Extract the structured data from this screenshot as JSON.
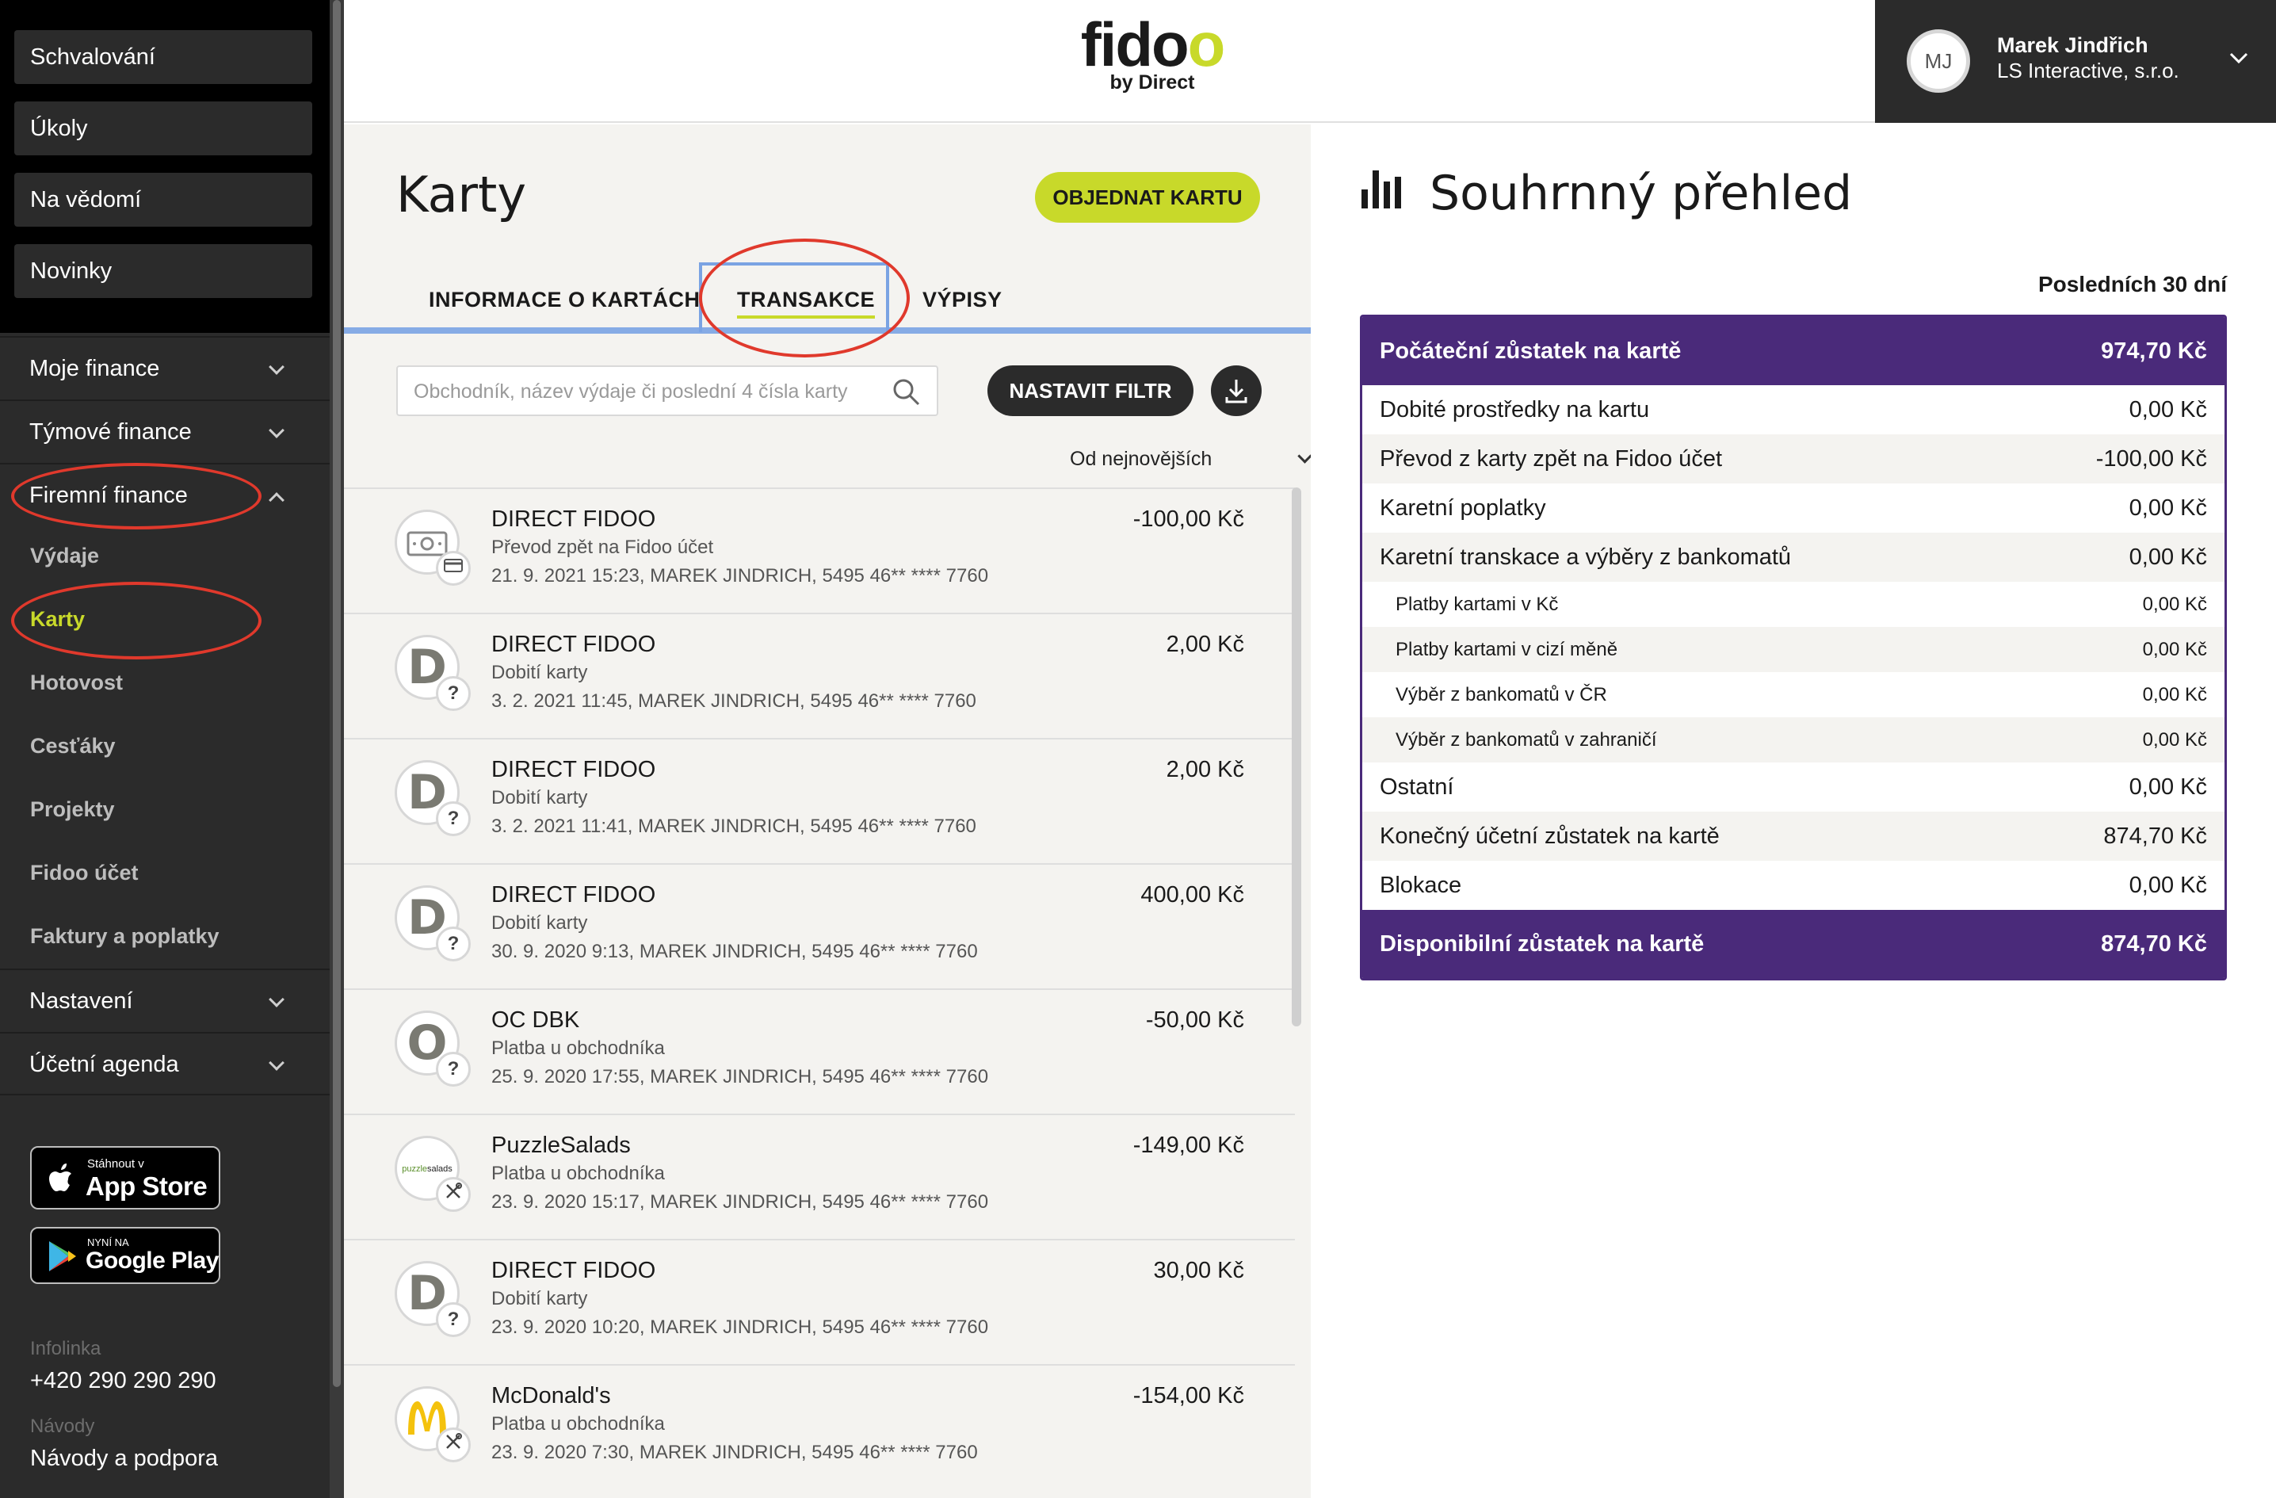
{
  "sidebar": {
    "top_buttons": [
      "Schvalování",
      "Úkoly",
      "Na vědomí",
      "Novinky"
    ],
    "sections": {
      "moje_finance": "Moje finance",
      "tymove_finance": "Týmové finance",
      "firemni_finance": "Firemní finance",
      "nastaveni": "Nastavení",
      "ucetni_agenda": "Účetní agenda"
    },
    "sub_items": [
      "Výdaje",
      "Karty",
      "Hotovost",
      "Cesťáky",
      "Projekty",
      "Fidoo účet",
      "Faktury a poplatky"
    ],
    "active_sub_item": "Karty",
    "app_store": {
      "small": "Stáhnout v",
      "big": "App Store"
    },
    "google_play": {
      "small": "NYNÍ NA",
      "big": "Google Play"
    },
    "hotline_label": "Infolinka",
    "hotline_value": "+420 290 290 290",
    "guides_label": "Návody",
    "guides_value": "Návody a podpora"
  },
  "header": {
    "logo_word": "fidoo",
    "logo_sub": "by Direct",
    "user": {
      "initials": "MJ",
      "name": "Marek Jindřich",
      "company": "LS Interactive, s.r.o."
    }
  },
  "cards_page": {
    "title": "Karty",
    "order_button": "OBJEDNAT KARTU",
    "tabs": {
      "info": "INFORMACE O KARTÁCH",
      "transactions": "TRANSAKCE",
      "statements": "VÝPISY"
    },
    "active_tab": "TRANSAKCE",
    "search_placeholder": "Obchodník, název výdaje či poslední 4 čísla karty",
    "filter_button": "NASTAVIT FILTR",
    "sort_label": "Od nejnovějších",
    "transactions": [
      {
        "merchant": "DIRECT FIDOO",
        "category": "Převod zpět na Fidoo účet",
        "meta": "21. 9. 2021 15:23, MAREK JINDRICH, 5495 46** **** 7760",
        "amount": "-100,00 Kč",
        "avatar": "money-icon",
        "badge": "card-icon"
      },
      {
        "merchant": "DIRECT FIDOO",
        "category": "Dobití karty",
        "meta": "3. 2. 2021 11:45, MAREK JINDRICH, 5495 46** **** 7760",
        "amount": "2,00 Kč",
        "avatar": "D",
        "badge": "?"
      },
      {
        "merchant": "DIRECT FIDOO",
        "category": "Dobití karty",
        "meta": "3. 2. 2021 11:41, MAREK JINDRICH, 5495 46** **** 7760",
        "amount": "2,00 Kč",
        "avatar": "D",
        "badge": "?"
      },
      {
        "merchant": "DIRECT FIDOO",
        "category": "Dobití karty",
        "meta": "30. 9. 2020 9:13, MAREK JINDRICH, 5495 46** **** 7760",
        "amount": "400,00 Kč",
        "avatar": "D",
        "badge": "?"
      },
      {
        "merchant": "OC DBK",
        "category": "Platba u obchodníka",
        "meta": "25. 9. 2020 17:55, MAREK JINDRICH, 5495 46** **** 7760",
        "amount": "-50,00 Kč",
        "avatar": "O",
        "badge": "?"
      },
      {
        "merchant": "PuzzleSalads",
        "category": "Platba u obchodníka",
        "meta": "23. 9. 2020 15:17, MAREK JINDRICH, 5495 46** **** 7760",
        "amount": "-149,00 Kč",
        "avatar": "puzzle-salads-logo",
        "badge": "cutlery-icon"
      },
      {
        "merchant": "DIRECT FIDOO",
        "category": "Dobití karty",
        "meta": "23. 9. 2020 10:20, MAREK JINDRICH, 5495 46** **** 7760",
        "amount": "30,00 Kč",
        "avatar": "D",
        "badge": "?"
      },
      {
        "merchant": "McDonald's",
        "category": "Platba u obchodníka",
        "meta": "23. 9. 2020 7:30, MAREK JINDRICH, 5495 46** **** 7760",
        "amount": "-154,00 Kč",
        "avatar": "mcdonalds-logo",
        "badge": "cutlery-icon"
      }
    ]
  },
  "summary": {
    "title": "Souhrnný přehled",
    "period": "Posledních 30 dní",
    "head": {
      "label": "Počáteční zůstatek na kartě",
      "value": "974,70 Kč"
    },
    "rows": [
      {
        "label": "Dobité prostředky na kartu",
        "value": "0,00 Kč",
        "sub": false
      },
      {
        "label": "Převod z karty zpět na Fidoo účet",
        "value": "-100,00 Kč",
        "sub": false
      },
      {
        "label": "Karetní poplatky",
        "value": "0,00 Kč",
        "sub": false
      },
      {
        "label": "Karetní transkace a výběry z bankomatů",
        "value": "0,00 Kč",
        "sub": false
      },
      {
        "label": "Platby kartami v Kč",
        "value": "0,00 Kč",
        "sub": true
      },
      {
        "label": "Platby kartami v cizí měně",
        "value": "0,00 Kč",
        "sub": true
      },
      {
        "label": "Výběr z bankomatů v ČR",
        "value": "0,00 Kč",
        "sub": true
      },
      {
        "label": "Výběr z bankomatů v zahraničí",
        "value": "0,00 Kč",
        "sub": true
      },
      {
        "label": "Ostatní",
        "value": "0,00 Kč",
        "sub": false
      },
      {
        "label": "Konečný účetní zůstatek na kartě",
        "value": "874,70 Kč",
        "sub": false
      },
      {
        "label": "Blokace",
        "value": "0,00 Kč",
        "sub": false
      }
    ],
    "foot": {
      "label": "Disponibilní zůstatek na kartě",
      "value": "874,70 Kč"
    }
  },
  "colors": {
    "accent": "#c8d92a",
    "summary_purple": "#4a2a7a",
    "annotation_red": "#e0392c",
    "tab_highlight_blue": "#7aa3e3"
  }
}
